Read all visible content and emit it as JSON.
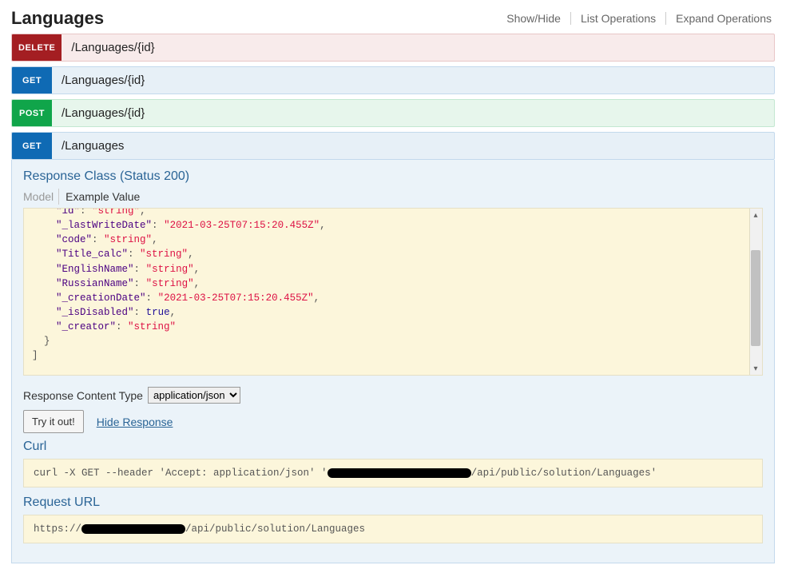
{
  "section": {
    "title": "Languages",
    "showHide": "Show/Hide",
    "listOps": "List Operations",
    "expandOps": "Expand Operations"
  },
  "ops": [
    {
      "method": "DELETE",
      "path": "/Languages/{id}"
    },
    {
      "method": "GET",
      "path": "/Languages/{id}"
    },
    {
      "method": "POST",
      "path": "/Languages/{id}"
    },
    {
      "method": "GET",
      "path": "/Languages"
    }
  ],
  "response": {
    "classLabel": "Response Class (Status 200)",
    "tabModel": "Model",
    "tabExample": "Example Value",
    "json": {
      "fields": [
        {
          "key": "_lastWriteDate",
          "value": "2021-03-25T07:15:20.455Z",
          "type": "string"
        },
        {
          "key": "code",
          "value": "string",
          "type": "string"
        },
        {
          "key": "Title_calc",
          "value": "string",
          "type": "string"
        },
        {
          "key": "EnglishName",
          "value": "string",
          "type": "string"
        },
        {
          "key": "RussianName",
          "value": "string",
          "type": "string"
        },
        {
          "key": "_creationDate",
          "value": "2021-03-25T07:15:20.455Z",
          "type": "string"
        },
        {
          "key": "_isDisabled",
          "value": "true",
          "type": "bool"
        },
        {
          "key": "_creator",
          "value": "string",
          "type": "string",
          "last": true
        }
      ],
      "truncatedFirstLine": "string"
    },
    "contentTypeLabel": "Response Content Type",
    "contentTypeValue": "application/json",
    "tryButton": "Try it out!",
    "hideResponse": "Hide Response"
  },
  "curl": {
    "heading": "Curl",
    "prefix": "curl -X GET --header 'Accept: application/json' '",
    "suffix": "/api/public/solution/Languages'"
  },
  "requestUrl": {
    "heading": "Request URL",
    "prefix": "https://",
    "suffix": "/api/public/solution/Languages"
  }
}
